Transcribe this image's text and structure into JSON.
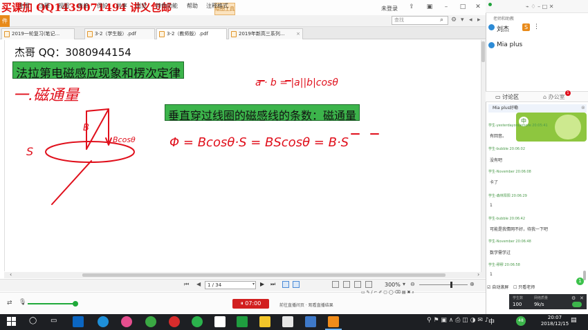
{
  "promo": {
    "text": "买课加 QQ1439071494 讲义包邮"
  },
  "tool_tab": {
    "label": "绘图工具"
  },
  "titlebar": {
    "login": "未登录"
  },
  "menu": {
    "file": "件",
    "items": [
      "主页",
      "注释",
      "视图",
      "表单",
      "保护",
      "共享",
      "浏览",
      "特色功能",
      "帮助",
      "注释格式"
    ]
  },
  "search": {
    "placeholder": "查找"
  },
  "tabs": [
    {
      "label": "2019一轮复习(笔记..."
    },
    {
      "label": "3-2（学生版）.pdf"
    },
    {
      "label": "3-2（教师版）.pdf"
    },
    {
      "label": "2019年新高三系列..."
    }
  ],
  "doc": {
    "author": "杰哥 QQ：3080944154",
    "title": "法拉第电磁感应现象和楞次定律",
    "definition": "垂直穿过线圈的磁感线的条数：磁通量",
    "hw_heading": "一.磁通量",
    "hw_dot": "a · b = |a||b|cosθ",
    "hw_formula": "Φ = Bcosθ·S = BScosθ = B·S",
    "hw_s": "S",
    "hw_b": "B",
    "hw_bcos": "Bcosθ"
  },
  "status": {
    "page": "1 / 34",
    "zoom": "300%"
  },
  "player": {
    "rec_time": "07:00",
    "rec_msg": "前往直播间页 · 观看直播结果"
  },
  "sidebar": {
    "top_label": "老师和助教",
    "teacher": "刘杰",
    "teacher_badge": "S",
    "mia": "Mia plus",
    "tab_discussion": "讨论区",
    "tab_office": "办公室",
    "office_badge": "1",
    "notice_from": "Mia plus好嘞",
    "chat": [
      {
        "user": "学生-yesterdayoncemore  20:05:41",
        "msg": "有回音。"
      },
      {
        "user": "学生-bubble  20:06:02",
        "msg": "没有吧"
      },
      {
        "user": "学生-November  20:06:08",
        "msg": "卡了"
      },
      {
        "user": "学生-森林阳阳  20:06:29",
        "msg": "1"
      },
      {
        "user": "学生-bubble  20:06:42",
        "msg": "可能是我情网不好，待我一下吧"
      },
      {
        "user": "学生-November  20:06:48",
        "msg": "数学需学过"
      },
      {
        "user": "学生-穆穆  20:06:58",
        "msg": "1"
      }
    ],
    "autoscroll": "自动滚屏",
    "only_teacher": "只看老师",
    "stats": {
      "students_label": "学生数",
      "students": "100",
      "net_label": "网络质量",
      "net": "9k/s",
      "unread": "1"
    }
  },
  "taskbar": {
    "time": "20:07",
    "date": "2018/12/15",
    "lang": "中",
    "notif": "48"
  },
  "colors": {
    "highlight": "#3cb44b",
    "ink": "#e0101c",
    "rec": "#d21f1f",
    "brand_orange": "#e88a1a"
  }
}
